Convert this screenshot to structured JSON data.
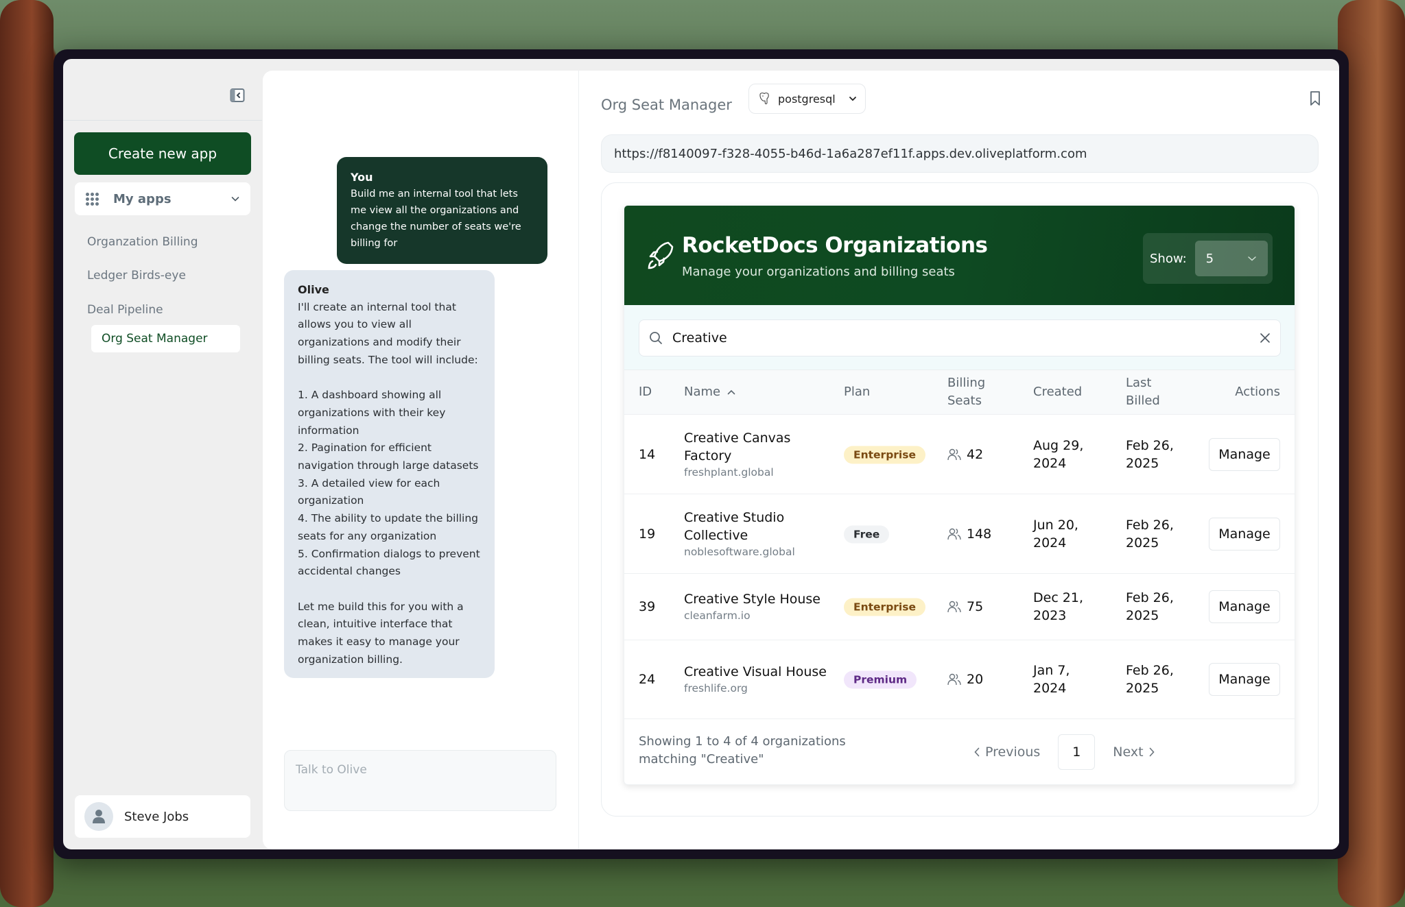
{
  "sidebar": {
    "create_button": "Create new app",
    "my_apps_label": "My apps",
    "apps": [
      {
        "label": "Organzation Billing",
        "active": false
      },
      {
        "label": "Ledger Birds-eye",
        "active": false
      },
      {
        "label": "Deal Pipeline",
        "active": false
      },
      {
        "label": "Org Seat Manager",
        "active": true
      }
    ],
    "user_name": "Steve Jobs"
  },
  "chat": {
    "messages": [
      {
        "sender": "You",
        "text": "Build me an internal tool that lets me view all the organizations and change the number of seats we're billing for"
      },
      {
        "sender": "Olive",
        "text": "I'll create an internal tool that allows you to view all organizations and modify their billing seats. The tool will include:\n\n1. A dashboard showing all organizations with their key information\n2. Pagination for efficient navigation through large datasets\n3. A detailed view for each organization\n4. The ability to update the billing seats for any organization\n5. Confirmation dialogs to prevent accidental changes\n\nLet me build this for you with a clean, intuitive interface that makes it easy to manage your organization billing."
      }
    ],
    "input_placeholder": "Talk to Olive"
  },
  "preview": {
    "title": "Org Seat Manager",
    "database": "postgresql",
    "url": "https://f8140097-f328-4055-b46d-1a6a287ef11f.apps.dev.oliveplatform.com",
    "icons": [
      "bookmark-icon",
      "share-icon"
    ]
  },
  "app": {
    "title": "RocketDocs Organizations",
    "subtitle": "Manage your organizations and billing seats",
    "show_label": "Show:",
    "show_value": "5",
    "search_value": "Creative",
    "columns": {
      "id": "ID",
      "name": "Name",
      "plan": "Plan",
      "seats_line1": "Billing",
      "seats_line2": "Seats",
      "created": "Created",
      "billed_line1": "Last",
      "billed_line2": "Billed",
      "actions": "Actions"
    },
    "rows": [
      {
        "id": "14",
        "name_line1": "Creative Canvas",
        "name_line2": "Factory",
        "domain": "freshplant.global",
        "plan": "Enterprise",
        "seats": "42",
        "created_line1": "Aug 29,",
        "created_line2": "2024",
        "billed_line1": "Feb 26,",
        "billed_line2": "2025",
        "action": "Manage"
      },
      {
        "id": "19",
        "name_line1": "Creative Studio",
        "name_line2": "Collective",
        "domain": "noblesoftware.global",
        "plan": "Free",
        "seats": "148",
        "created_line1": "Jun 20,",
        "created_line2": "2024",
        "billed_line1": "Feb 26,",
        "billed_line2": "2025",
        "action": "Manage"
      },
      {
        "id": "39",
        "name_line1": "Creative Style House",
        "name_line2": "",
        "domain": "cleanfarm.io",
        "plan": "Enterprise",
        "seats": "75",
        "created_line1": "Dec 21,",
        "created_line2": "2023",
        "billed_line1": "Feb 26,",
        "billed_line2": "2025",
        "action": "Manage"
      },
      {
        "id": "24",
        "name_line1": "Creative Visual House",
        "name_line2": "",
        "domain": "freshlife.org",
        "plan": "Premium",
        "seats": "20",
        "created_line1": "Jan 7,",
        "created_line2": "2024",
        "billed_line1": "Feb 26,",
        "billed_line2": "2025",
        "action": "Manage"
      }
    ],
    "footer_line1": "Showing 1 to 4 of 4 organizations",
    "footer_line2": "matching \"Creative\"",
    "prev_label": "Previous",
    "current_page": "1",
    "next_label": "Next"
  },
  "colors": {
    "brand_green": "#0f4d24",
    "user_bubble": "#16372a",
    "assistant_bubble": "#e2e8ef",
    "badge_enterprise_bg": "#fdf1c7",
    "badge_enterprise_fg": "#7a4a12",
    "badge_free_bg": "#f1f3f5",
    "badge_free_fg": "#2b2f33",
    "badge_premium_bg": "#f1e6fb",
    "badge_premium_fg": "#5e2a86"
  }
}
